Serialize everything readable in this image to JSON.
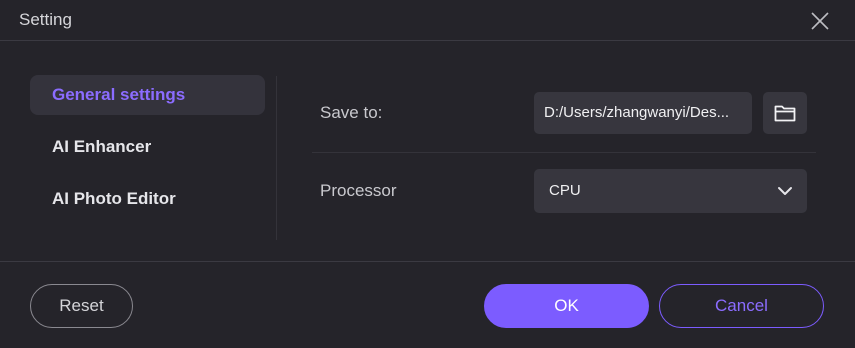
{
  "window": {
    "title": "Setting",
    "close_icon": "close-icon"
  },
  "sidebar": {
    "items": [
      {
        "label": "General settings",
        "active": true
      },
      {
        "label": "AI Enhancer",
        "active": false
      },
      {
        "label": "AI Photo Editor",
        "active": false
      }
    ]
  },
  "general": {
    "save_to": {
      "label": "Save to:",
      "value": "D:/Users/zhangwanyi/Des...",
      "browse_icon": "folder-icon"
    },
    "processor": {
      "label": "Processor",
      "selected": "CPU",
      "dropdown_icon": "chevron-down-icon"
    }
  },
  "footer": {
    "reset_label": "Reset",
    "ok_label": "OK",
    "cancel_label": "Cancel"
  },
  "colors": {
    "background": "#25242a",
    "accent": "#7c5cff",
    "accent_text": "#8b6cff",
    "field_bg": "#37363e"
  }
}
